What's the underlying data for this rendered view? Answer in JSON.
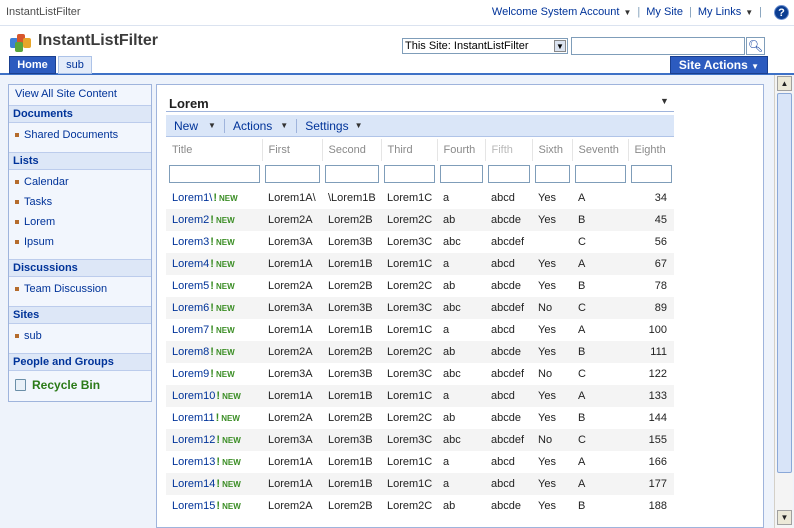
{
  "top": {
    "site_name": "InstantListFilter",
    "welcome": "Welcome System Account",
    "my_site": "My Site",
    "my_links": "My Links",
    "help": "?"
  },
  "header": {
    "title": "InstantListFilter",
    "scope": "This Site: InstantListFilter",
    "search_placeholder": ""
  },
  "nav": {
    "tabs": [
      {
        "label": "Home",
        "active": true
      },
      {
        "label": "sub",
        "active": false
      }
    ],
    "site_actions": "Site Actions"
  },
  "sidebar": {
    "view_all": "View All Site Content",
    "documents": {
      "header": "Documents",
      "items": [
        "Shared Documents"
      ]
    },
    "lists": {
      "header": "Lists",
      "items": [
        "Calendar",
        "Tasks",
        "Lorem",
        "Ipsum"
      ]
    },
    "discussions": {
      "header": "Discussions",
      "items": [
        "Team Discussion"
      ]
    },
    "sites": {
      "header": "Sites",
      "items": [
        "sub"
      ]
    },
    "people": "People and Groups",
    "recycle": "Recycle Bin"
  },
  "webpart": {
    "title": "Lorem",
    "toolbar": {
      "new": "New",
      "actions": "Actions",
      "settings": "Settings"
    }
  },
  "table": {
    "columns": [
      "Title",
      "First",
      "Second",
      "Third",
      "Fourth",
      "Fifth",
      "Sixth",
      "Seventh",
      "Eighth"
    ],
    "new_label": "NEW",
    "rows": [
      [
        "Lorem1\\",
        "Lorem1A\\",
        "\\Lorem1B",
        "Lorem1C",
        "a",
        "abcd",
        "Yes",
        "A",
        "34"
      ],
      [
        "Lorem2",
        "Lorem2A",
        "Lorem2B",
        "Lorem2C",
        "ab",
        "abcde",
        "Yes",
        "B",
        "45"
      ],
      [
        "Lorem3",
        "Lorem3A",
        "Lorem3B",
        "Lorem3C",
        "abc",
        "abcdef",
        "",
        "C",
        "56"
      ],
      [
        "Lorem4",
        "Lorem1A",
        "Lorem1B",
        "Lorem1C",
        "a",
        "abcd",
        "Yes",
        "A",
        "67"
      ],
      [
        "Lorem5",
        "Lorem2A",
        "Lorem2B",
        "Lorem2C",
        "ab",
        "abcde",
        "Yes",
        "B",
        "78"
      ],
      [
        "Lorem6",
        "Lorem3A",
        "Lorem3B",
        "Lorem3C",
        "abc",
        "abcdef",
        "No",
        "C",
        "89"
      ],
      [
        "Lorem7",
        "Lorem1A",
        "Lorem1B",
        "Lorem1C",
        "a",
        "abcd",
        "Yes",
        "A",
        "100"
      ],
      [
        "Lorem8",
        "Lorem2A",
        "Lorem2B",
        "Lorem2C",
        "ab",
        "abcde",
        "Yes",
        "B",
        "111"
      ],
      [
        "Lorem9",
        "Lorem3A",
        "Lorem3B",
        "Lorem3C",
        "abc",
        "abcdef",
        "No",
        "C",
        "122"
      ],
      [
        "Lorem10",
        "Lorem1A",
        "Lorem1B",
        "Lorem1C",
        "a",
        "abcd",
        "Yes",
        "A",
        "133"
      ],
      [
        "Lorem11",
        "Lorem2A",
        "Lorem2B",
        "Lorem2C",
        "ab",
        "abcde",
        "Yes",
        "B",
        "144"
      ],
      [
        "Lorem12",
        "Lorem3A",
        "Lorem3B",
        "Lorem3C",
        "abc",
        "abcdef",
        "No",
        "C",
        "155"
      ],
      [
        "Lorem13",
        "Lorem1A",
        "Lorem1B",
        "Lorem1C",
        "a",
        "abcd",
        "Yes",
        "A",
        "166"
      ],
      [
        "Lorem14",
        "Lorem1A",
        "Lorem1B",
        "Lorem1C",
        "a",
        "abcd",
        "Yes",
        "A",
        "177"
      ],
      [
        "Lorem15",
        "Lorem2A",
        "Lorem2B",
        "Lorem2C",
        "ab",
        "abcde",
        "Yes",
        "B",
        "188"
      ]
    ]
  }
}
